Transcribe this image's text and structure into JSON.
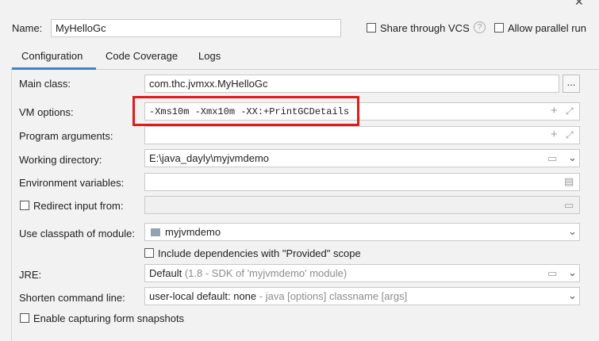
{
  "window": {
    "close_glyph": "✕"
  },
  "header": {
    "name_label": "Name:",
    "name_value": "MyHelloGc",
    "share_label": "Share through VCS",
    "help_glyph": "?",
    "parallel_label": "Allow parallel run"
  },
  "tabs": [
    {
      "label": "Configuration"
    },
    {
      "label": "Code Coverage"
    },
    {
      "label": "Logs"
    }
  ],
  "form": {
    "main_class_label": "Main class:",
    "main_class_value": "com.thc.jvmxx.MyHelloGc",
    "browse_label": "...",
    "vm_options_label": "VM options:",
    "vm_options_value": "-Xms10m -Xmx10m -XX:+PrintGCDetails",
    "program_args_label": "Program arguments:",
    "working_dir_label": "Working directory:",
    "working_dir_value": "E:\\java_dayly\\myjvmdemo",
    "env_vars_label": "Environment variables:",
    "redirect_label": "Redirect input from:",
    "classpath_label": "Use classpath of module:",
    "module_value": "myjvmdemo",
    "include_deps_label": "Include dependencies with \"Provided\" scope",
    "jre_label": "JRE:",
    "jre_value": "Default",
    "jre_detail": "(1.8 - SDK of 'myjvmdemo' module)",
    "shorten_label": "Shorten command line:",
    "shorten_value": "user-local default: none",
    "shorten_detail": "- java [options] classname [args]",
    "capture_label": "Enable capturing form snapshots"
  },
  "colors": {
    "highlight_box": "#e01b1b",
    "tab_underline": "#4083c9"
  }
}
